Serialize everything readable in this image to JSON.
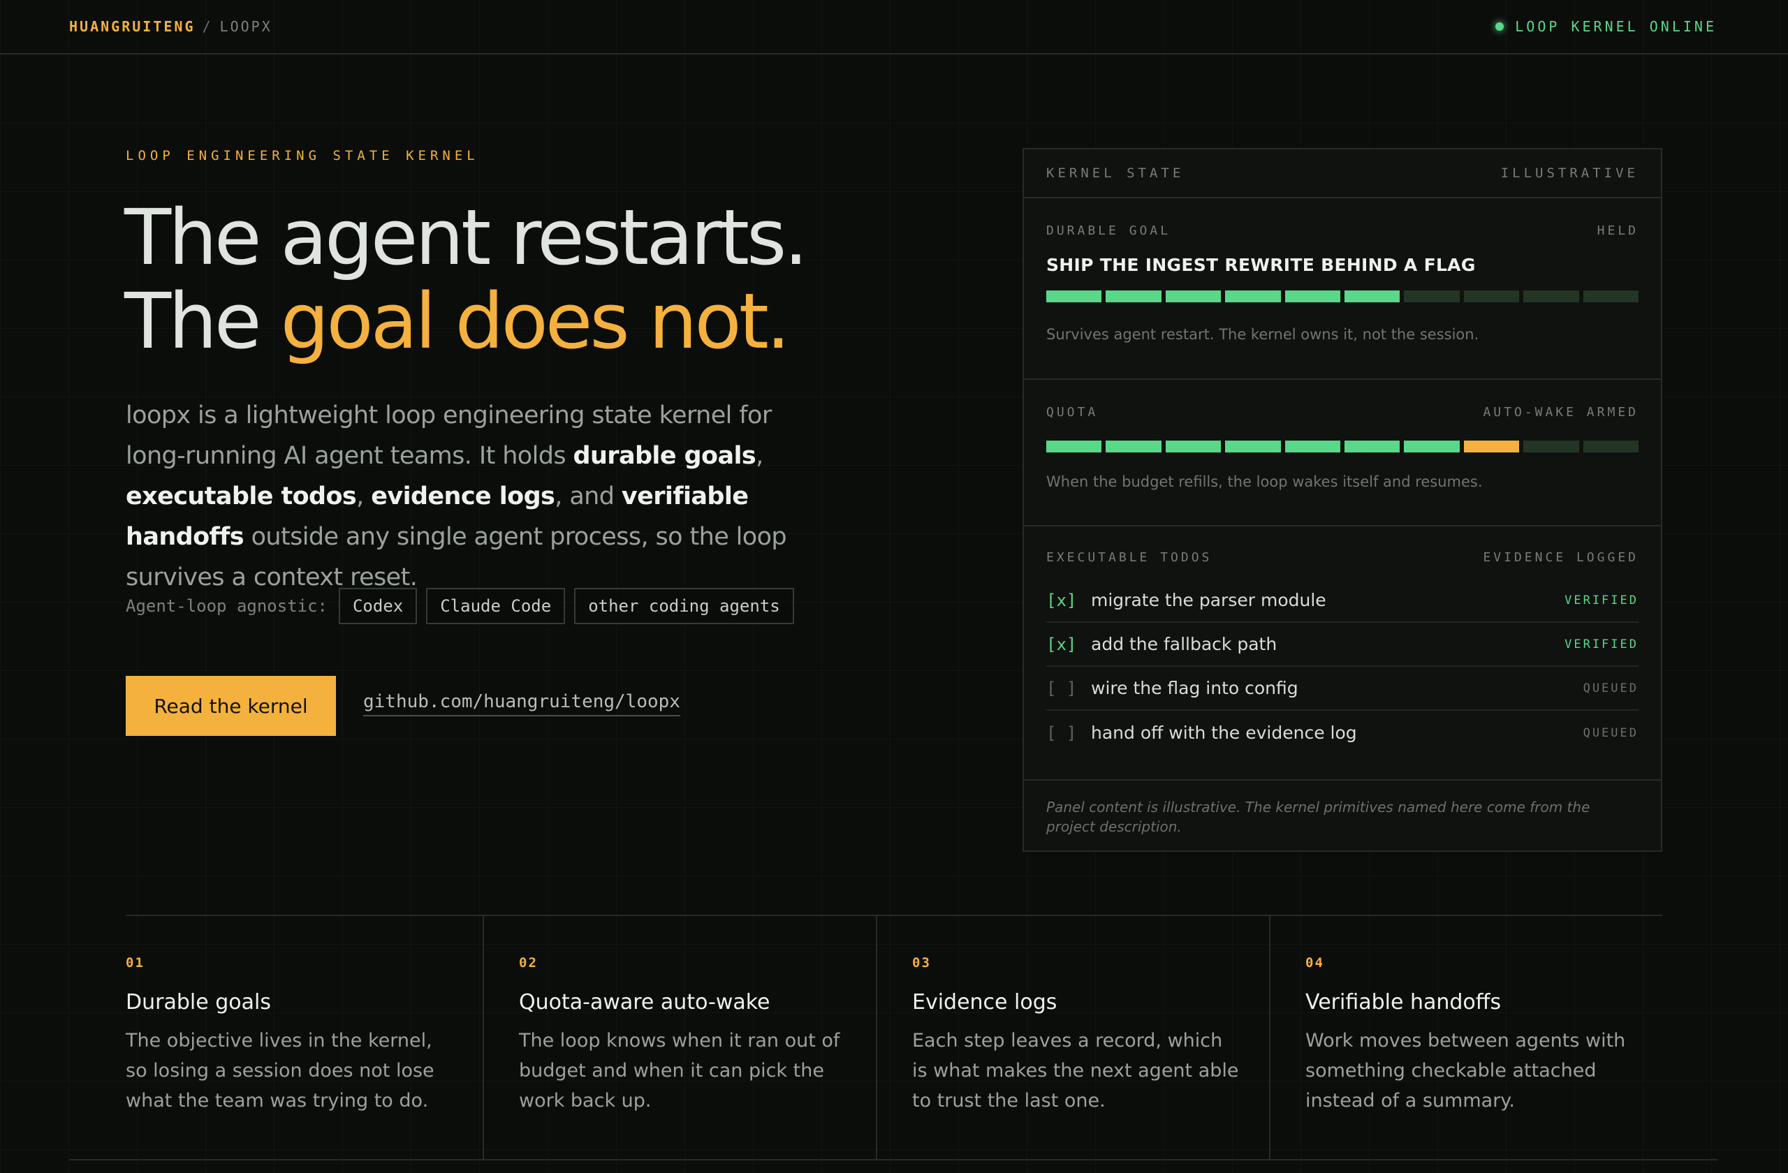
{
  "nav": {
    "owner": "HUANGRUITENG",
    "separator": "/",
    "repo": "LOOPX",
    "status": "LOOP KERNEL ONLINE"
  },
  "hero": {
    "eyebrow": "LOOP ENGINEERING STATE KERNEL",
    "headline_line1": "The agent restarts.",
    "headline_line2_prefix": "The ",
    "headline_line2_accent": "goal does not.",
    "lede": {
      "t1": "loopx is a lightweight loop engineering state kernel for long-running AI agent teams. It holds ",
      "b1": "durable goals",
      "t2": ", ",
      "b2": "executable todos",
      "t3": ", ",
      "b3": "evidence logs",
      "t4": ", and ",
      "b4": "verifiable handoffs",
      "t5": " outside any single agent process, so the loop survives a context reset."
    },
    "agnostic_label": "Agent-loop agnostic:",
    "agents": [
      "Codex",
      "Claude Code",
      "other coding agents"
    ],
    "cta_label": "Read the kernel",
    "repo_link": "github.com/huangruiteng/loopx"
  },
  "panel": {
    "title": "KERNEL STATE",
    "tag": "ILLUSTRATIVE",
    "goal": {
      "label": "DURABLE GOAL",
      "status": "HELD",
      "title": "SHIP THE INGEST REWRITE BEHIND A FLAG",
      "progress": 0.6,
      "note": "Survives agent restart. The kernel owns it, not the session."
    },
    "quota": {
      "label": "QUOTA",
      "status": "AUTO-WAKE ARMED",
      "used": 0.7,
      "warning": 0.1,
      "note": "When the budget refills, the loop wakes itself and resumes."
    },
    "todos": {
      "label": "EXECUTABLE TODOS",
      "status": "EVIDENCE LOGGED",
      "items": [
        {
          "box": "[x]",
          "text": "migrate the parser module",
          "state": "VERIFIED"
        },
        {
          "box": "[x]",
          "text": "add the fallback path",
          "state": "VERIFIED"
        },
        {
          "box": "[ ]",
          "text": "wire the flag into config",
          "state": "QUEUED"
        },
        {
          "box": "[ ]",
          "text": "hand off with the evidence log",
          "state": "QUEUED"
        }
      ]
    },
    "footnote": "Panel content is illustrative. The kernel primitives named here come from the project description."
  },
  "features": [
    {
      "num": "01",
      "title": "Durable goals",
      "desc": "The objective lives in the kernel, so losing a session does not lose what the team was trying to do."
    },
    {
      "num": "02",
      "title": "Quota-aware auto-wake",
      "desc": "The loop knows when it ran out of budget and when it can pick the work back up."
    },
    {
      "num": "03",
      "title": "Evidence logs",
      "desc": "Each step leaves a record, which is what makes the next agent able to trust the last one."
    },
    {
      "num": "04",
      "title": "Verifiable handoffs",
      "desc": "Work moves between agents with something checkable attached instead of a summary."
    }
  ],
  "colors": {
    "accent": "#f5b13d",
    "success": "#59d88a",
    "background": "#0b0d0b"
  }
}
